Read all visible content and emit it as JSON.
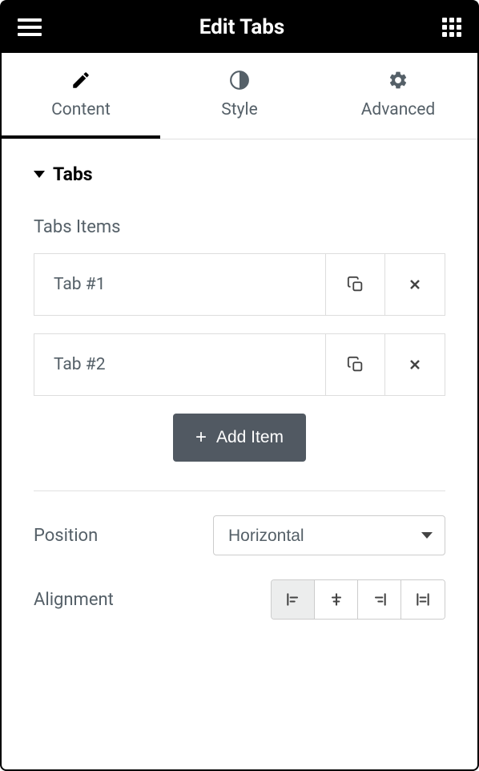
{
  "header": {
    "title": "Edit Tabs"
  },
  "navTabs": [
    {
      "label": "Content",
      "active": true,
      "icon": "pencil"
    },
    {
      "label": "Style",
      "active": false,
      "icon": "half-circle"
    },
    {
      "label": "Advanced",
      "active": false,
      "icon": "gear"
    }
  ],
  "section": {
    "title": "Tabs"
  },
  "tabsItems": {
    "label": "Tabs Items",
    "items": [
      {
        "name": "Tab #1"
      },
      {
        "name": "Tab #2"
      }
    ],
    "addButton": "Add Item"
  },
  "controls": {
    "position": {
      "label": "Position",
      "value": "Horizontal"
    },
    "alignment": {
      "label": "Alignment",
      "options": [
        "left",
        "center",
        "right",
        "justify"
      ],
      "selected": "left"
    }
  }
}
